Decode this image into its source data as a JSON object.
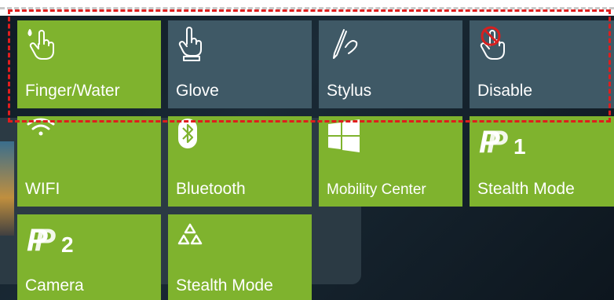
{
  "touch_modes": [
    {
      "label": "Finger/Water",
      "icon": "finger-water-icon",
      "state": "selected"
    },
    {
      "label": "Glove",
      "icon": "glove-icon",
      "state": "unselected"
    },
    {
      "label": "Stylus",
      "icon": "stylus-icon",
      "state": "unselected"
    },
    {
      "label": "Disable",
      "icon": "touch-disable-icon",
      "state": "unselected"
    }
  ],
  "quick_tiles": [
    {
      "label": "WIFI",
      "icon": "wifi-icon"
    },
    {
      "label": "Bluetooth",
      "icon": "bluetooth-icon"
    },
    {
      "label": "Mobility Center",
      "icon": "windows-icon"
    },
    {
      "label": "Stealth Mode",
      "icon": "p1-icon",
      "badge": "1"
    },
    {
      "label": "Camera",
      "icon": "p2-icon",
      "badge": "2"
    },
    {
      "label": "Stealth Mode",
      "icon": "stealth-triangle-icon"
    }
  ],
  "colors": {
    "tile_green": "#7fb32e",
    "tile_slate": "#3f5966",
    "highlight_dash": "#e01d1d"
  }
}
